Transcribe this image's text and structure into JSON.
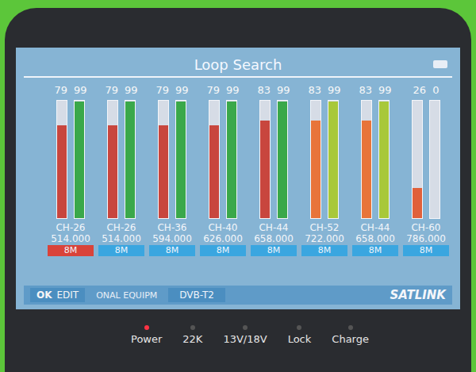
{
  "screen": {
    "title": "Loop Search"
  },
  "channels": [
    {
      "strength": "79",
      "quality": "99",
      "strength_level": 0.79,
      "quality_level": 0.99,
      "strength_color": "#c8463e",
      "quality_color": "#3aa84a",
      "channel": "CH-26",
      "frequency": "514.000",
      "bandwidth": "8M",
      "selected": true
    },
    {
      "strength": "79",
      "quality": "99",
      "strength_level": 0.79,
      "quality_level": 0.99,
      "strength_color": "#c8463e",
      "quality_color": "#3aa84a",
      "channel": "CH-26",
      "frequency": "514.000",
      "bandwidth": "8M",
      "selected": false
    },
    {
      "strength": "79",
      "quality": "99",
      "strength_level": 0.79,
      "quality_level": 0.99,
      "strength_color": "#c8463e",
      "quality_color": "#3aa84a",
      "channel": "CH-36",
      "frequency": "594.000",
      "bandwidth": "8M",
      "selected": false
    },
    {
      "strength": "79",
      "quality": "99",
      "strength_level": 0.79,
      "quality_level": 0.99,
      "strength_color": "#c8463e",
      "quality_color": "#3aa84a",
      "channel": "CH-40",
      "frequency": "626.000",
      "bandwidth": "8M",
      "selected": false
    },
    {
      "strength": "83",
      "quality": "99",
      "strength_level": 0.83,
      "quality_level": 0.99,
      "strength_color": "#c8463e",
      "quality_color": "#3aa84a",
      "channel": "CH-44",
      "frequency": "658.000",
      "bandwidth": "8M",
      "selected": false
    },
    {
      "strength": "83",
      "quality": "99",
      "strength_level": 0.83,
      "quality_level": 0.99,
      "strength_color": "#e8743a",
      "quality_color": "#a8c83a",
      "channel": "CH-52",
      "frequency": "722.000",
      "bandwidth": "8M",
      "selected": false
    },
    {
      "strength": "83",
      "quality": "99",
      "strength_level": 0.83,
      "quality_level": 0.99,
      "strength_color": "#e8743a",
      "quality_color": "#a8c83a",
      "channel": "CH-44",
      "frequency": "658.000",
      "bandwidth": "8M",
      "selected": false
    },
    {
      "strength": "26",
      "quality": "0",
      "strength_level": 0.26,
      "quality_level": 0,
      "strength_color": "#e0603a",
      "quality_color": "#a8c83a",
      "channel": "CH-60",
      "frequency": "786.000",
      "bandwidth": "8M",
      "selected": false
    }
  ],
  "footer": {
    "ok": "OK",
    "edit": "EDIT",
    "info": "ONAL EQUIPM",
    "standard": "DVB-T2",
    "brand": "SATLINK"
  },
  "indicators": [
    {
      "label": "Power",
      "lit": true
    },
    {
      "label": "22K",
      "lit": false
    },
    {
      "label": "13V/18V",
      "lit": false
    },
    {
      "label": "Lock",
      "lit": false
    },
    {
      "label": "Charge",
      "lit": false
    }
  ]
}
